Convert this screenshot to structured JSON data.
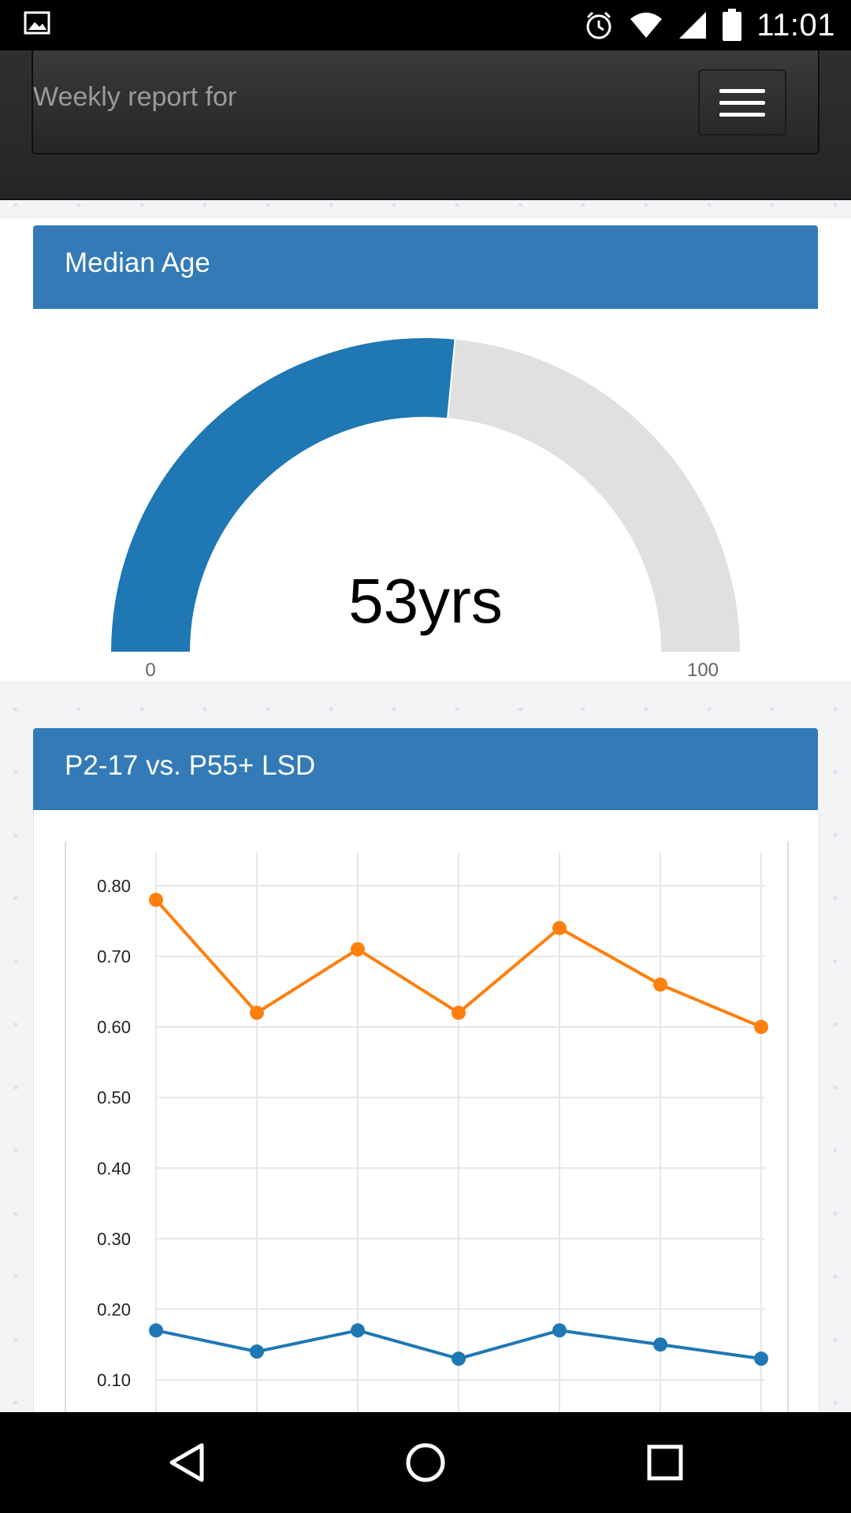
{
  "status_bar": {
    "time": "11:01",
    "icons": [
      "gallery-icon",
      "alarm-icon",
      "wifi-icon",
      "signal-icon",
      "battery-icon"
    ]
  },
  "header": {
    "title": "Weekly report for",
    "menu_icon": "hamburger-icon"
  },
  "gauge": {
    "title": "Median Age",
    "value": 53,
    "min": 0,
    "max": 100,
    "display": "53yrs",
    "min_label": "0",
    "max_label": "100",
    "fill_color": "#1f77b4",
    "track_color": "#e0e0e0"
  },
  "chart_card": {
    "title": "P2-17 vs. P55+ LSD"
  },
  "chart_data": {
    "type": "line",
    "x": [
      1,
      2,
      3,
      4,
      5,
      6,
      7
    ],
    "ylim": [
      0.1,
      0.8
    ],
    "yticks": [
      "0.80",
      "0.70",
      "0.60",
      "0.50",
      "0.40",
      "0.30",
      "0.20",
      "0.10"
    ],
    "grid": true,
    "series": [
      {
        "color": "#ff7f0e",
        "values": [
          0.78,
          0.62,
          0.71,
          0.62,
          0.74,
          0.66,
          0.6
        ]
      },
      {
        "color": "#1f77b4",
        "values": [
          0.17,
          0.14,
          0.17,
          0.13,
          0.17,
          0.15,
          0.13
        ]
      }
    ]
  },
  "nav_bar": {
    "icons": [
      "back-icon",
      "home-icon",
      "recents-icon"
    ]
  }
}
